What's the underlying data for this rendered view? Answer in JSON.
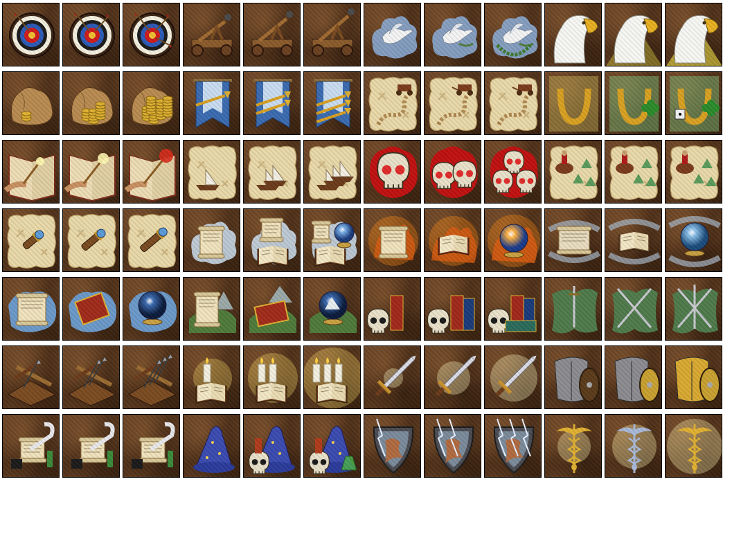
{
  "grid": {
    "columns": 12,
    "rows": [
      {
        "skill": "archery",
        "icons": [
          {
            "name": "archery-basic-icon",
            "motif": "target",
            "level": 1
          },
          {
            "name": "archery-advanced-icon",
            "motif": "target",
            "level": 2
          },
          {
            "name": "archery-expert-icon",
            "motif": "target",
            "level": 3
          }
        ]
      },
      {
        "skill": "ballistics",
        "icons": [
          {
            "name": "ballistics-basic-icon",
            "motif": "catapult",
            "level": 1
          },
          {
            "name": "ballistics-advanced-icon",
            "motif": "catapult",
            "level": 2
          },
          {
            "name": "ballistics-expert-icon",
            "motif": "catapult",
            "level": 3
          }
        ]
      },
      {
        "skill": "diplomacy",
        "icons": [
          {
            "name": "diplomacy-basic-icon",
            "motif": "dove",
            "level": 1
          },
          {
            "name": "diplomacy-advanced-icon",
            "motif": "dove",
            "level": 2
          },
          {
            "name": "diplomacy-expert-icon",
            "motif": "dove",
            "level": 3
          }
        ]
      },
      {
        "skill": "eagle-eye",
        "icons": [
          {
            "name": "eagle-eye-basic-icon",
            "motif": "eagle",
            "level": 1
          },
          {
            "name": "eagle-eye-advanced-icon",
            "motif": "eagle",
            "level": 2
          },
          {
            "name": "eagle-eye-expert-icon",
            "motif": "eagle",
            "level": 3
          }
        ]
      },
      {
        "skill": "estates",
        "icons": [
          {
            "name": "estates-basic-icon",
            "motif": "gold-sack",
            "level": 1
          },
          {
            "name": "estates-advanced-icon",
            "motif": "gold-sack",
            "level": 2
          },
          {
            "name": "estates-expert-icon",
            "motif": "gold-sack",
            "level": 3
          }
        ]
      },
      {
        "skill": "leadership",
        "icons": [
          {
            "name": "leadership-basic-icon",
            "motif": "banner-trumpet",
            "level": 1
          },
          {
            "name": "leadership-advanced-icon",
            "motif": "banner-trumpet",
            "level": 2
          },
          {
            "name": "leadership-expert-icon",
            "motif": "banner-trumpet",
            "level": 3
          }
        ]
      },
      {
        "skill": "logistics",
        "icons": [
          {
            "name": "logistics-basic-icon",
            "motif": "map-cart",
            "level": 1
          },
          {
            "name": "logistics-advanced-icon",
            "motif": "map-cart",
            "level": 2
          },
          {
            "name": "logistics-expert-icon",
            "motif": "map-cart",
            "level": 3
          }
        ]
      },
      {
        "skill": "luck",
        "icons": [
          {
            "name": "luck-basic-icon",
            "motif": "horseshoe",
            "level": 1
          },
          {
            "name": "luck-advanced-icon",
            "motif": "horseshoe",
            "level": 2
          },
          {
            "name": "luck-expert-icon",
            "motif": "horseshoe",
            "level": 3
          }
        ]
      },
      {
        "skill": "mysticism",
        "icons": [
          {
            "name": "mysticism-basic-icon",
            "motif": "book-wand",
            "level": 1
          },
          {
            "name": "mysticism-advanced-icon",
            "motif": "book-wand",
            "level": 2
          },
          {
            "name": "mysticism-expert-icon",
            "motif": "book-wand",
            "level": 3
          }
        ]
      },
      {
        "skill": "navigation",
        "icons": [
          {
            "name": "navigation-basic-icon",
            "motif": "map-ship",
            "level": 1
          },
          {
            "name": "navigation-advanced-icon",
            "motif": "map-ship",
            "level": 2
          },
          {
            "name": "navigation-expert-icon",
            "motif": "map-ship",
            "level": 3
          }
        ]
      },
      {
        "skill": "necromancy",
        "icons": [
          {
            "name": "necromancy-basic-icon",
            "motif": "skulls",
            "level": 1
          },
          {
            "name": "necromancy-advanced-icon",
            "motif": "skulls",
            "level": 2
          },
          {
            "name": "necromancy-expert-icon",
            "motif": "skulls",
            "level": 3
          }
        ]
      },
      {
        "skill": "pathfinding",
        "icons": [
          {
            "name": "pathfinding-basic-icon",
            "motif": "map-rider",
            "level": 1
          },
          {
            "name": "pathfinding-advanced-icon",
            "motif": "map-rider",
            "level": 2
          },
          {
            "name": "pathfinding-expert-icon",
            "motif": "map-rider",
            "level": 3
          }
        ]
      },
      {
        "skill": "scouting",
        "icons": [
          {
            "name": "scouting-basic-icon",
            "motif": "map-spyglass",
            "level": 1
          },
          {
            "name": "scouting-advanced-icon",
            "motif": "map-spyglass",
            "level": 2
          },
          {
            "name": "scouting-expert-icon",
            "motif": "map-spyglass",
            "level": 3
          }
        ]
      },
      {
        "skill": "wisdom",
        "icons": [
          {
            "name": "wisdom-scroll-icon",
            "motif": "cloud-scroll",
            "level": 1
          },
          {
            "name": "wisdom-book-icon",
            "motif": "cloud-book",
            "level": 2
          },
          {
            "name": "wisdom-orb-icon",
            "motif": "cloud-orb",
            "level": 3
          }
        ]
      },
      {
        "skill": "fire-magic",
        "icons": [
          {
            "name": "fire-magic-scroll-icon",
            "motif": "fire-scroll",
            "level": 1
          },
          {
            "name": "fire-magic-book-icon",
            "motif": "fire-book",
            "level": 2
          },
          {
            "name": "fire-magic-orb-icon",
            "motif": "fire-orb",
            "level": 3
          }
        ]
      },
      {
        "skill": "air-magic",
        "icons": [
          {
            "name": "air-magic-scroll-icon",
            "motif": "air-scroll",
            "level": 1
          },
          {
            "name": "air-magic-book-icon",
            "motif": "air-book",
            "level": 2
          },
          {
            "name": "air-magic-orb-icon",
            "motif": "air-orb",
            "level": 3
          }
        ]
      },
      {
        "skill": "water-magic",
        "icons": [
          {
            "name": "water-magic-scroll-icon",
            "motif": "water-scroll",
            "level": 1
          },
          {
            "name": "water-magic-book-icon",
            "motif": "water-book",
            "level": 2
          },
          {
            "name": "water-magic-orb-icon",
            "motif": "water-orb",
            "level": 3
          }
        ]
      },
      {
        "skill": "earth-magic",
        "icons": [
          {
            "name": "earth-magic-scroll-icon",
            "motif": "earth-scroll",
            "level": 1
          },
          {
            "name": "earth-magic-book-icon",
            "motif": "earth-book",
            "level": 2
          },
          {
            "name": "earth-magic-orb-icon",
            "motif": "earth-orb",
            "level": 3
          }
        ]
      },
      {
        "skill": "scholar",
        "icons": [
          {
            "name": "scholar-basic-icon",
            "motif": "skull-books",
            "level": 1
          },
          {
            "name": "scholar-advanced-icon",
            "motif": "skull-books",
            "level": 2
          },
          {
            "name": "scholar-expert-icon",
            "motif": "skull-books",
            "level": 3
          }
        ]
      },
      {
        "skill": "tactics",
        "icons": [
          {
            "name": "tactics-basic-icon",
            "motif": "swords-cloth",
            "level": 1
          },
          {
            "name": "tactics-advanced-icon",
            "motif": "swords-cloth",
            "level": 2
          },
          {
            "name": "tactics-expert-icon",
            "motif": "swords-cloth",
            "level": 3
          }
        ]
      },
      {
        "skill": "artillery",
        "icons": [
          {
            "name": "artillery-basic-icon",
            "motif": "ballista",
            "level": 1
          },
          {
            "name": "artillery-advanced-icon",
            "motif": "ballista",
            "level": 2
          },
          {
            "name": "artillery-expert-icon",
            "motif": "ballista",
            "level": 3
          }
        ]
      },
      {
        "skill": "learning",
        "icons": [
          {
            "name": "learning-basic-icon",
            "motif": "candle-book",
            "level": 1
          },
          {
            "name": "learning-advanced-icon",
            "motif": "candle-book",
            "level": 2
          },
          {
            "name": "learning-expert-icon",
            "motif": "candle-book",
            "level": 3
          }
        ]
      },
      {
        "skill": "offense",
        "icons": [
          {
            "name": "offense-basic-icon",
            "motif": "sword",
            "level": 1
          },
          {
            "name": "offense-advanced-icon",
            "motif": "sword",
            "level": 2
          },
          {
            "name": "offense-expert-icon",
            "motif": "sword",
            "level": 3
          }
        ]
      },
      {
        "skill": "armorer",
        "icons": [
          {
            "name": "armorer-basic-icon",
            "motif": "armor-shield",
            "level": 1
          },
          {
            "name": "armorer-advanced-icon",
            "motif": "armor-shield",
            "level": 2
          },
          {
            "name": "armorer-expert-icon",
            "motif": "armor-shield",
            "level": 3
          }
        ]
      },
      {
        "skill": "intelligence",
        "icons": [
          {
            "name": "intelligence-basic-icon",
            "motif": "scroll-quill",
            "level": 1
          },
          {
            "name": "intelligence-advanced-icon",
            "motif": "scroll-quill",
            "level": 2
          },
          {
            "name": "intelligence-expert-icon",
            "motif": "scroll-quill",
            "level": 3
          }
        ]
      },
      {
        "skill": "sorcery",
        "icons": [
          {
            "name": "sorcery-basic-icon",
            "motif": "wizard-hat",
            "level": 1
          },
          {
            "name": "sorcery-advanced-icon",
            "motif": "wizard-hat",
            "level": 2
          },
          {
            "name": "sorcery-expert-icon",
            "motif": "wizard-hat",
            "level": 3
          }
        ]
      },
      {
        "skill": "resistance",
        "icons": [
          {
            "name": "resistance-basic-icon",
            "motif": "lightning-shield",
            "level": 1
          },
          {
            "name": "resistance-advanced-icon",
            "motif": "lightning-shield",
            "level": 2
          },
          {
            "name": "resistance-expert-icon",
            "motif": "lightning-shield",
            "level": 3
          }
        ]
      },
      {
        "skill": "first-aid",
        "icons": [
          {
            "name": "first-aid-basic-icon",
            "motif": "caduceus",
            "level": 1
          },
          {
            "name": "first-aid-advanced-icon",
            "motif": "caduceus",
            "level": 2
          },
          {
            "name": "first-aid-expert-icon",
            "motif": "caduceus",
            "level": 3
          }
        ]
      }
    ]
  },
  "colors": {
    "tile_border": "#000000",
    "leather_brown": "#5a3a1f",
    "parchment": "#e8d8a8",
    "gold": "#e0b030",
    "blood_red": "#c01010",
    "sky_blue": "#6a98c8",
    "grass_green": "#4f7a3a"
  }
}
